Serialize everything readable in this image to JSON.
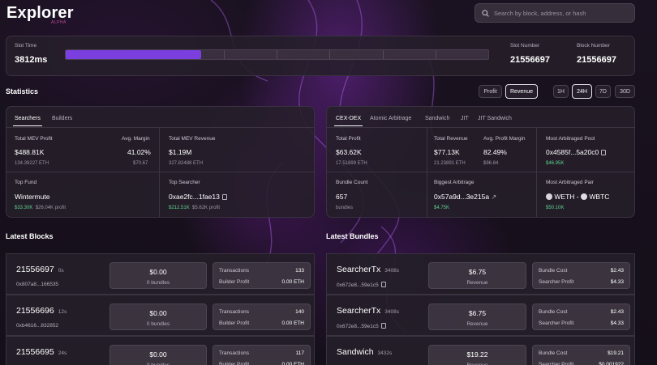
{
  "header": {
    "title": "Explorer",
    "badge": "ALPHA",
    "search_placeholder": "Search by block, address, or hash"
  },
  "slot": {
    "slot_time_label": "Slot Time",
    "slot_time_value": "3812ms",
    "progress_fraction": 0.32,
    "slot_number_label": "Slot Number",
    "slot_number_value": "21556697",
    "block_number_label": "Block Number",
    "block_number_value": "21556697"
  },
  "statistics": {
    "title": "Statistics",
    "metric_toggles": [
      "Profit",
      "Revenue"
    ],
    "active_metric": "Revenue",
    "range_toggles": [
      "1H",
      "24H",
      "7D",
      "30D"
    ],
    "active_range": "24H",
    "left": {
      "tabs": [
        "Searchers",
        "Builders"
      ],
      "total_mev_profit_label": "Total MEV Profit",
      "total_mev_profit": "$488.81K",
      "total_mev_profit_eth": "134.39227 ETH",
      "avg_margin_label": "Avg. Margin",
      "avg_margin": "41.02%",
      "avg_margin_sub": "$70.67",
      "total_mev_revenue_label": "Total MEV Revenue",
      "total_mev_revenue": "$1.19M",
      "total_mev_revenue_eth": "327.82488 ETH",
      "top_fund_label": "Top Fund",
      "top_fund": "Wintermute",
      "top_fund_rev": "$33.30K",
      "top_fund_profit": "$26.04K profit",
      "top_searcher_label": "Top Searcher",
      "top_searcher": "0xae2fc...1fae13",
      "top_searcher_rev": "$212.51K",
      "top_searcher_profit": "$5.62K profit"
    },
    "right": {
      "tabs": [
        "CEX-DEX",
        "Atomic Arbitrage",
        "Sandwich",
        "JIT",
        "JIT Sandwich"
      ],
      "total_profit_label": "Total Profit",
      "total_profit": "$63.62K",
      "total_profit_eth": "17.51899 ETH",
      "total_revenue_label": "Total Revenue",
      "total_revenue": "$77.13K",
      "total_revenue_eth": "21.23891 ETH",
      "avg_profit_margin_label": "Avg. Profit Margin",
      "avg_profit_margin": "82.49%",
      "avg_profit_margin_sub": "$96.84",
      "most_arb_pool_label": "Most Arbitraged Pool",
      "most_arb_pool": "0x4585f...5a20c0",
      "most_arb_pool_value": "$46.95K",
      "bundle_count_label": "Bundle Count",
      "bundle_count": "657",
      "bundle_count_unit": "bundles",
      "biggest_arb_label": "Biggest Arbitrage",
      "biggest_arb": "0x57a9d...3e215a",
      "biggest_arb_value": "$4.75K",
      "most_arb_pair_label": "Most Arbitraged Pair",
      "pair_a": "WETH",
      "pair_sep": "-",
      "pair_b": "WBTC",
      "most_arb_pair_value": "$50.10K"
    }
  },
  "latest_blocks": {
    "title": "Latest Blocks",
    "rows": [
      {
        "number": "21556697",
        "age": "0s",
        "hash": "0x807a8...166535",
        "value": "$0.00",
        "bundles": "0 bundles",
        "tx_label": "Transactions",
        "tx": "133",
        "bp_label": "Builder Profit",
        "bp": "0.00 ETH"
      },
      {
        "number": "21556696",
        "age": "12s",
        "hash": "0xb4616...832852",
        "value": "$0.00",
        "bundles": "0 bundles",
        "tx_label": "Transactions",
        "tx": "140",
        "bp_label": "Builder Profit",
        "bp": "0.00 ETH"
      },
      {
        "number": "21556695",
        "age": "24s",
        "hash": "",
        "value": "$0.00",
        "bundles": "0 bundles",
        "tx_label": "Transactions",
        "tx": "117",
        "bp_label": "Builder Profit",
        "bp": "0.00 ETH"
      }
    ]
  },
  "latest_bundles": {
    "title": "Latest Bundles",
    "rows": [
      {
        "type": "SearcherTx",
        "age": "3408s",
        "hash": "0x672e8...59e1c5",
        "value": "$6.75",
        "sub": "Revenue",
        "cost_label": "Bundle Cost",
        "cost": "$2.43",
        "profit_label": "Searcher Profit",
        "profit": "$4.33"
      },
      {
        "type": "SearcherTx",
        "age": "3408s",
        "hash": "0x672e8...59e1c5",
        "value": "$6.75",
        "sub": "Revenue",
        "cost_label": "Bundle Cost",
        "cost": "$2.43",
        "profit_label": "Searcher Profit",
        "profit": "$4.33"
      },
      {
        "type": "Sandwich",
        "age": "3432s",
        "hash": "",
        "value": "$19.22",
        "sub": "Revenue",
        "cost_label": "Bundle Cost",
        "cost": "$19.21",
        "profit_label": "Searcher Profit",
        "profit": "$0.001922"
      }
    ]
  }
}
